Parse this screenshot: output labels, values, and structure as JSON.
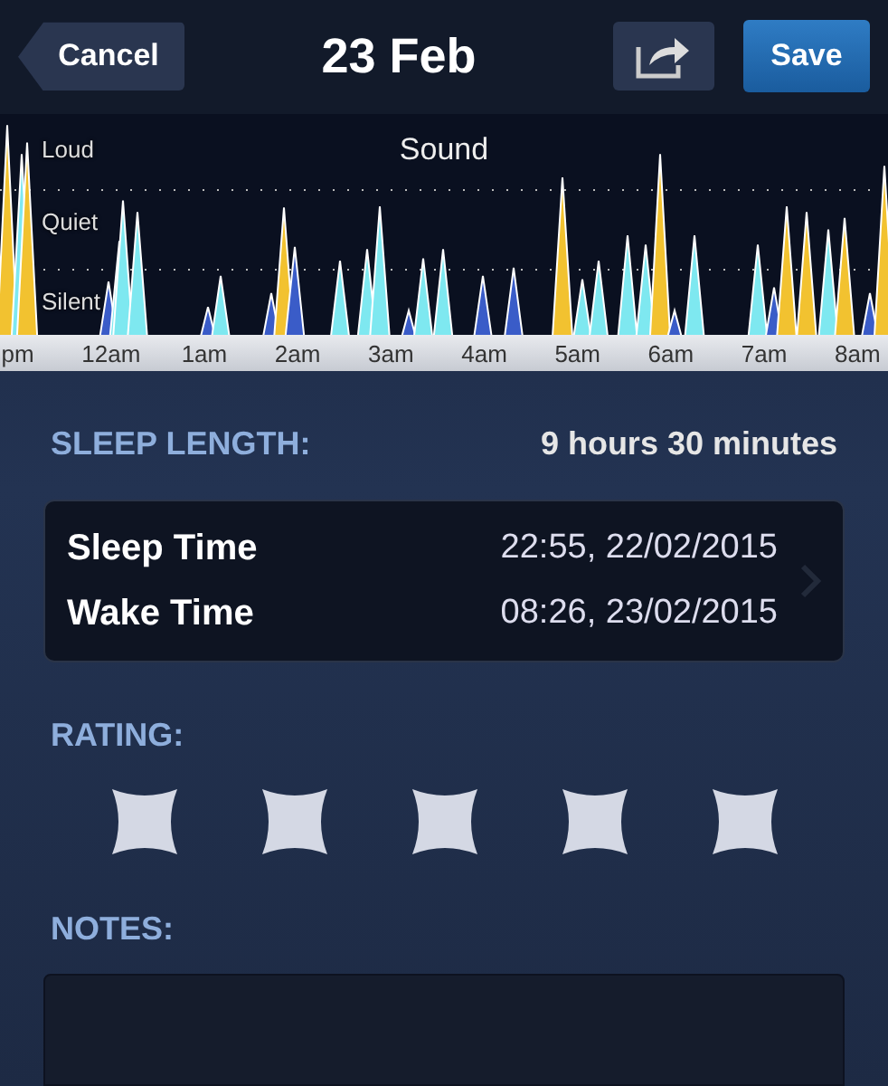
{
  "nav": {
    "cancel": "Cancel",
    "title": "23 Feb",
    "save": "Save"
  },
  "sound_chart": {
    "title": "Sound",
    "levels": [
      "Loud",
      "Quiet",
      "Silent"
    ],
    "times": [
      "pm",
      "12am",
      "1am",
      "2am",
      "3am",
      "4am",
      "5am",
      "6am",
      "7am",
      "8am"
    ]
  },
  "sleep_length": {
    "label": "SLEEP LENGTH:",
    "value": "9 hours 30 minutes"
  },
  "times": [
    {
      "label": "Sleep Time",
      "value": "22:55, 22/02/2015"
    },
    {
      "label": "Wake Time",
      "value": "08:26, 23/02/2015"
    }
  ],
  "rating": {
    "label": "RATING:",
    "stars": 5
  },
  "notes": {
    "label": "NOTES:"
  }
}
